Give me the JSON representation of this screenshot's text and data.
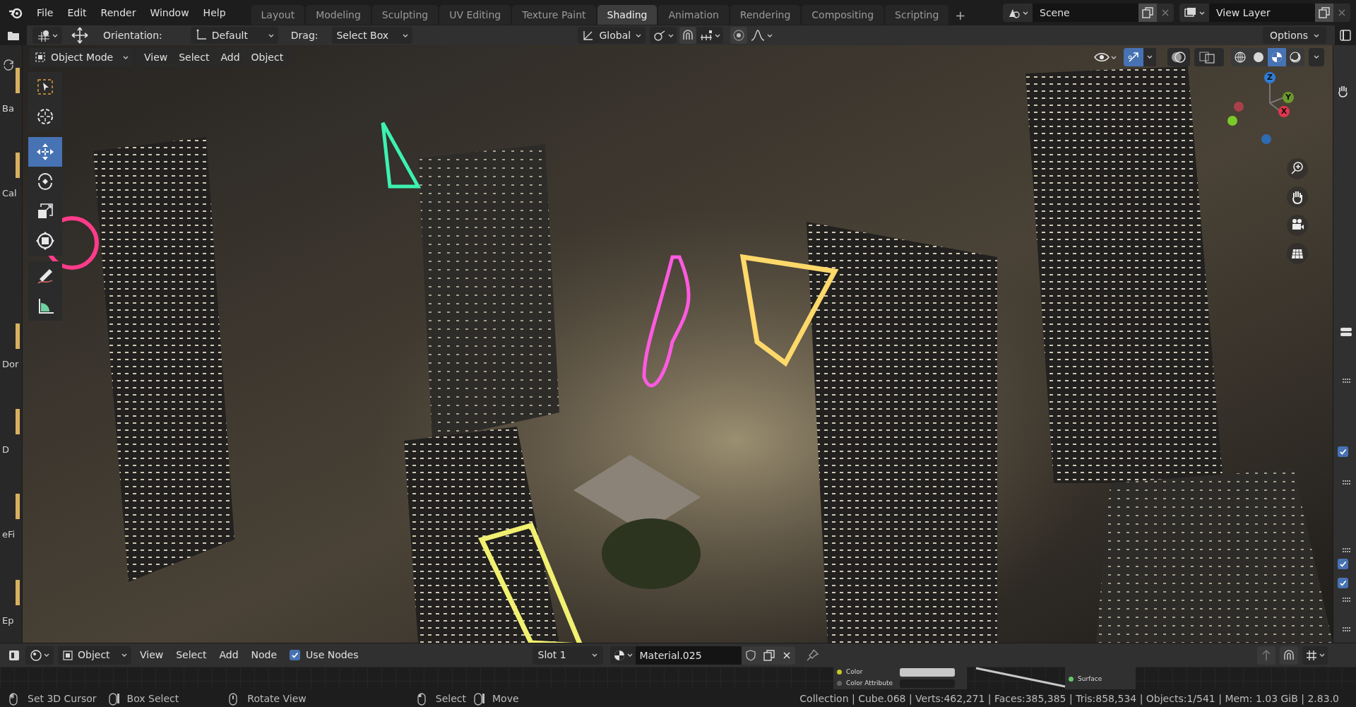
{
  "menu": [
    "File",
    "Edit",
    "Render",
    "Window",
    "Help"
  ],
  "workspaces": [
    {
      "label": "Layout",
      "selected": false
    },
    {
      "label": "Modeling",
      "selected": false
    },
    {
      "label": "Sculpting",
      "selected": false
    },
    {
      "label": "UV Editing",
      "selected": false
    },
    {
      "label": "Texture Paint",
      "selected": false
    },
    {
      "label": "Shading",
      "selected": true
    },
    {
      "label": "Animation",
      "selected": false
    },
    {
      "label": "Rendering",
      "selected": false
    },
    {
      "label": "Compositing",
      "selected": false
    },
    {
      "label": "Scripting",
      "selected": false
    }
  ],
  "add_workspace": "+",
  "scene": "Scene",
  "view_layer": "View Layer",
  "tool_header": {
    "orientation_label": "Orientation:",
    "orientation": "Default",
    "drag_label": "Drag:",
    "drag": "Select Box",
    "transform_orientation": "Global",
    "options": "Options"
  },
  "file_browser": [
    "Ba",
    "Cal",
    "Dor",
    "D",
    "eFi",
    "Ep"
  ],
  "viewport": {
    "mode": "Object Mode",
    "menus": [
      "View",
      "Select",
      "Add",
      "Object"
    ],
    "tools": [
      {
        "kind": "select_box",
        "selected": false
      },
      {
        "kind": "cursor",
        "selected": false
      },
      {
        "kind": "move",
        "selected": true
      },
      {
        "kind": "rotate",
        "selected": false
      },
      {
        "kind": "scale",
        "selected": false
      },
      {
        "kind": "transform",
        "selected": false
      },
      {
        "kind": "annotate",
        "selected": false
      },
      {
        "kind": "measure",
        "selected": false
      }
    ],
    "gizmo_toggle": {
      "on": true
    },
    "shading": [
      {
        "kind": "wireframe",
        "selected": false
      },
      {
        "kind": "solid",
        "selected": false
      },
      {
        "kind": "material",
        "selected": true
      },
      {
        "kind": "rendered",
        "selected": false
      }
    ],
    "axes": [
      {
        "label": "Z",
        "color": "#2e7ed8"
      },
      {
        "label": "Y",
        "color": "#6a9a2a"
      },
      {
        "label": "X",
        "color": "#e0364e"
      }
    ]
  },
  "node_editor": {
    "type": "Object",
    "menus": [
      "View",
      "Select",
      "Add",
      "Node"
    ],
    "use_nodes": {
      "label": "Use Nodes",
      "checked": true
    },
    "slot": "Slot 1",
    "material": "Material.025",
    "sockets": [
      {
        "label": "Color",
        "color": "#c7c729"
      },
      {
        "label": "Color Attribute",
        "color": "#636363"
      },
      {
        "label": "Surface",
        "color": "#63c763"
      }
    ]
  },
  "side_panel": {
    "checkboxes": [
      {
        "checked": true
      },
      {
        "checked": true
      },
      {
        "checked": true
      }
    ]
  },
  "status_bar": {
    "hints": [
      "Set 3D Cursor",
      "Box Select",
      "Rotate View",
      "Select",
      "Move"
    ],
    "stats": "Collection | Cube.068 | Verts:462,271 | Faces:385,385 | Tris:858,534 | Objects:1/541 | Mem: 1.03 GiB | 2.83.0"
  }
}
